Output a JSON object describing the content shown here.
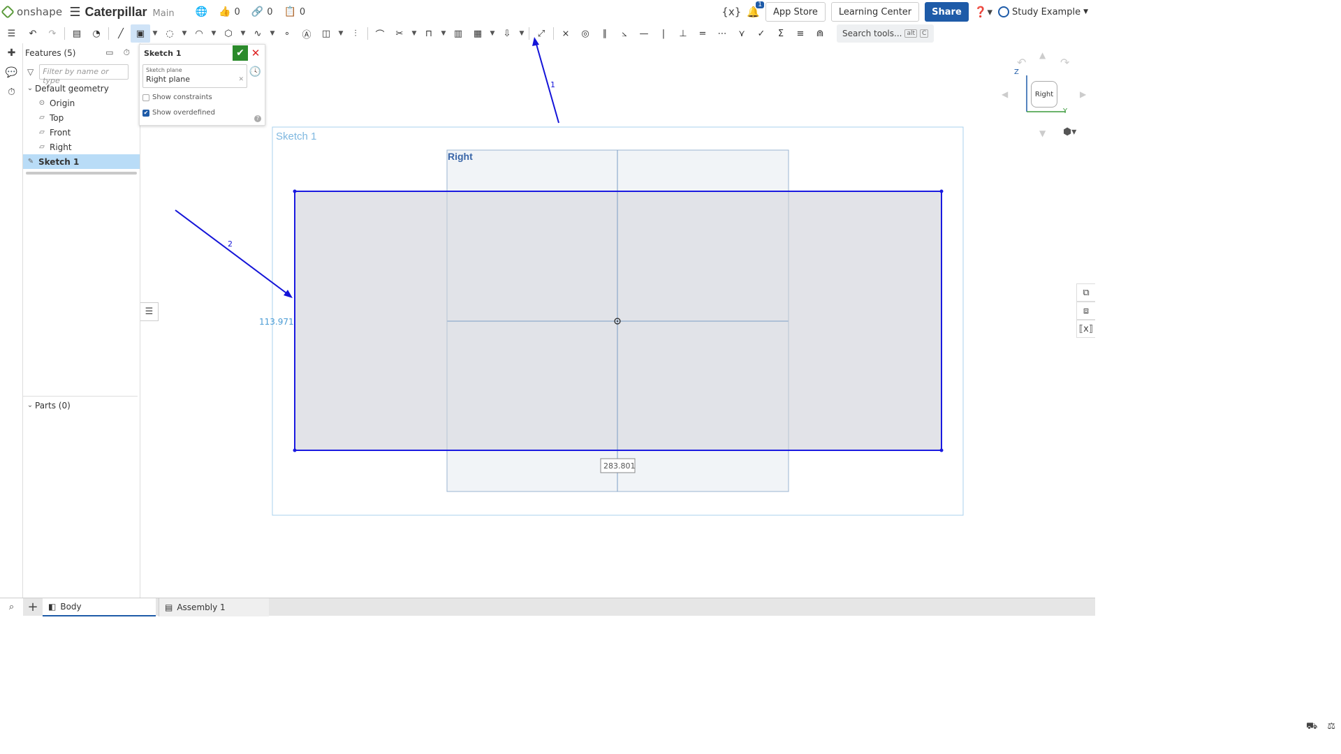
{
  "header": {
    "logo_text": "onshape",
    "doc_title": "Caterpillar",
    "branch": "Main",
    "likes": "0",
    "links": "0",
    "copies": "0",
    "app_store": "App Store",
    "learning_center": "Learning Center",
    "share": "Share",
    "notifications": "1",
    "user_name": "Study Example",
    "variables_icon": "{x}"
  },
  "toolbar": {
    "search_label": "Search tools...",
    "search_kbd_1": "alt",
    "search_kbd_2": "C"
  },
  "features": {
    "title": "Features (5)",
    "filter_placeholder": "Filter by name or type",
    "default_geometry": "Default geometry",
    "items": [
      {
        "label": "Origin"
      },
      {
        "label": "Top"
      },
      {
        "label": "Front"
      },
      {
        "label": "Right"
      }
    ],
    "sketch": "Sketch 1",
    "parts": "Parts (0)"
  },
  "sketch_dialog": {
    "title": "Sketch 1",
    "plane_label": "Sketch plane",
    "plane_value": "Right plane",
    "show_constraints": "Show constraints",
    "show_overdefined": "Show overdefined",
    "show_constraints_checked": false,
    "show_overdefined_checked": true
  },
  "viewport": {
    "sketch_label": "Sketch 1",
    "plane_label": "Right",
    "dim_height": "113.971",
    "dim_width": "283.801",
    "annotation_1": "1",
    "annotation_2": "2",
    "annotation_color": "#1414d8",
    "sketch_line_color": "#1a1ae0",
    "plane_fill": "#dfe1e6"
  },
  "viewcube": {
    "face": "Right",
    "axis_z": "Z",
    "axis_y": "Y"
  },
  "tabs": [
    {
      "label": "Body"
    },
    {
      "label": "Assembly 1"
    }
  ]
}
